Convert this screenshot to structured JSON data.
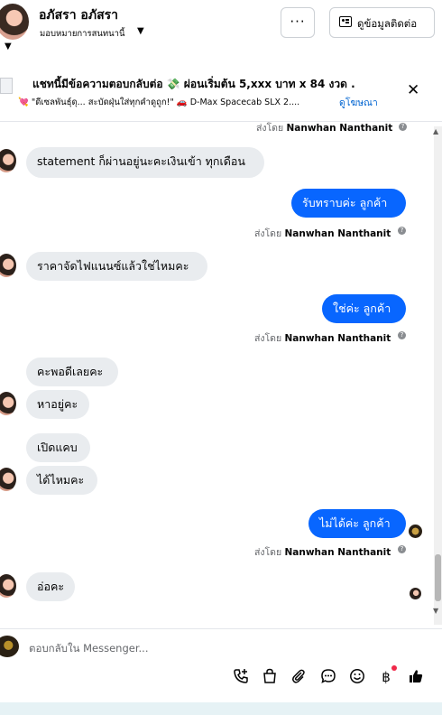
{
  "header": {
    "contact_name": "อภัสรา อภัสรา",
    "subtitle": "มอบหมายการสนทนานี้",
    "more_label": "···",
    "contact_info_label": "ดูข้อมูลติดต่อ"
  },
  "ad": {
    "title": "แชทนี้มีข้อความตอบกลับต่อ 💸 ผ่อนเริ่มต้น 5,xxx บาท x 84 งวด .",
    "subtitle": "💘 \"ดีเซลพันธุ์ดุ... สะบัดฝุ่นใส่ทุกคำดูถูก!\" 🚗 D-Max Spacecab SLX 2....",
    "link": "ดูโฆษณา",
    "close": "✕"
  },
  "conversation": {
    "top_sent_by": {
      "prefix": "ส่งโดย",
      "name": "Nanwhan Nanthanit"
    },
    "messages": [
      {
        "from": "customer",
        "text": "statement ก็ผ่านอยู่นะคะเงินเข้า ทุกเดือน"
      },
      {
        "from": "page",
        "text": "รับทราบค่ะ ลูกค้า",
        "sent_by_prefix": "ส่งโดย",
        "sent_by": "Nanwhan Nanthanit"
      },
      {
        "from": "customer",
        "text": "ราคาจัดไฟแนนซ์แล้วใช่ไหมคะ"
      },
      {
        "from": "page",
        "text": "ใช่ค่ะ ลูกค้า",
        "sent_by_prefix": "ส่งโดย",
        "sent_by": "Nanwhan Nanthanit"
      },
      {
        "from": "customer",
        "text": "คะพอดีเลยคะ"
      },
      {
        "from": "customer",
        "text": "หาอยู่คะ"
      },
      {
        "from": "customer",
        "text": "เปิดแคบ"
      },
      {
        "from": "customer",
        "text": "ได้ไหมคะ"
      },
      {
        "from": "page",
        "text": "ไม่ได้ค่ะ ลูกค้า",
        "sent_by_prefix": "ส่งโดย",
        "sent_by": "Nanwhan Nanthanit"
      },
      {
        "from": "customer",
        "text": "อ่อคะ"
      }
    ]
  },
  "composer": {
    "placeholder": "ตอบกลับใน Messenger...",
    "icons": [
      "phone-add-icon",
      "shopping-bag-icon",
      "attachment-icon",
      "chat-bubble-icon",
      "emoji-icon",
      "baht-icon",
      "thumbs-up-icon"
    ]
  },
  "colors": {
    "accent": "#0866ff",
    "incoming_bubble": "#e9ecef",
    "link": "#0064d1",
    "muted": "#65676b"
  }
}
